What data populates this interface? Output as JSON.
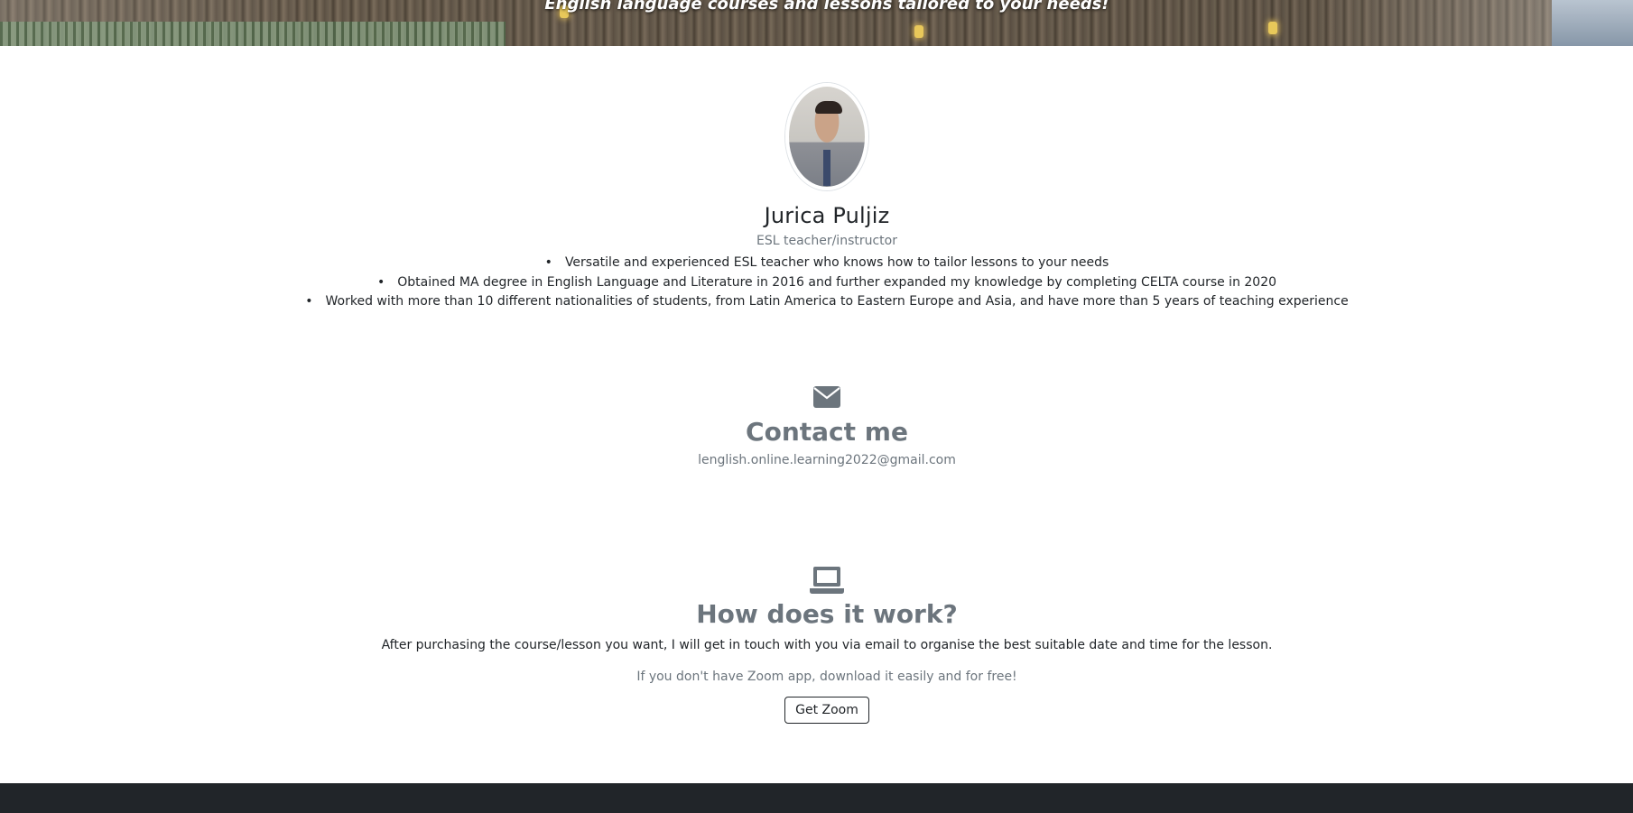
{
  "hero": {
    "subtitle": "English language courses and lessons tailored to your needs!"
  },
  "profile": {
    "name": "Jurica Puljiz",
    "role": "ESL teacher/instructor",
    "bullets": [
      "Versatile and experienced ESL teacher who knows how to tailor lessons to your needs",
      "Obtained MA degree in English Language and Literature in 2016 and further expanded my knowledge by completing CELTA course in 2020",
      "Worked with more than 10 different nationalities of students, from Latin America to Eastern Europe and Asia, and have more than 5 years of teaching experience"
    ]
  },
  "contact": {
    "icon": "envelope-icon",
    "title": "Contact me",
    "email": "lenglish.online.learning2022@gmail.com"
  },
  "how": {
    "icon": "laptop-icon",
    "title": "How does it work?",
    "description": "After purchasing the course/lesson you want, I will get in touch with you via email to organise the best suitable date and time for the lesson.",
    "note": "If you don't have Zoom app, download it easily and for free!",
    "button_label": "Get Zoom"
  },
  "colors": {
    "muted": "#6c757d",
    "dark": "#212529",
    "footer": "#212529"
  }
}
